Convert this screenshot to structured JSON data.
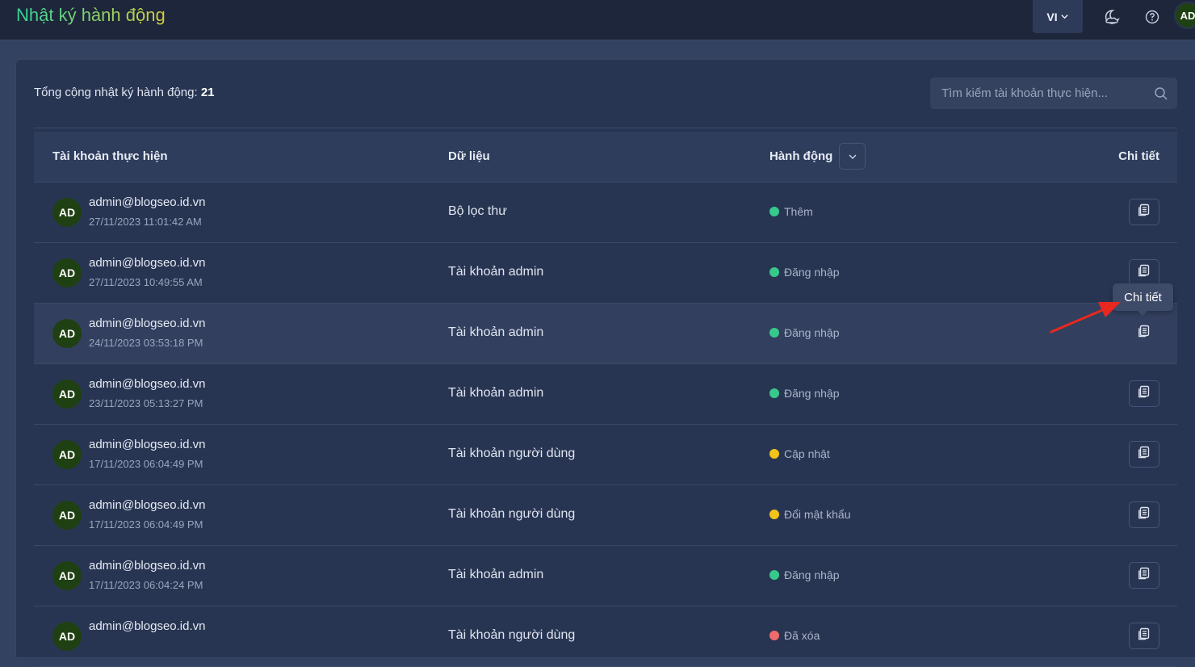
{
  "header": {
    "title": "Nhật ký hành động",
    "language": "VI",
    "avatar_initials": "AD"
  },
  "summary": {
    "label": "Tổng cộng nhật ký hành động:",
    "count": "21"
  },
  "search": {
    "placeholder": "Tìm kiếm tài khoản thực hiện..."
  },
  "table": {
    "columns": {
      "account": "Tài khoản thực hiện",
      "data": "Dữ liệu",
      "action": "Hành động",
      "detail": "Chi tiết"
    },
    "rows": [
      {
        "initials": "AD",
        "email": "admin@blogseo.id.vn",
        "time": "27/11/2023 11:01:42 AM",
        "data": "Bộ lọc thư",
        "action": "Thêm",
        "status_color": "#37c98b"
      },
      {
        "initials": "AD",
        "email": "admin@blogseo.id.vn",
        "time": "27/11/2023 10:49:55 AM",
        "data": "Tài khoản admin",
        "action": "Đăng nhập",
        "status_color": "#37c98b"
      },
      {
        "initials": "AD",
        "email": "admin@blogseo.id.vn",
        "time": "24/11/2023 03:53:18 PM",
        "data": "Tài khoản admin",
        "action": "Đăng nhập",
        "status_color": "#37c98b"
      },
      {
        "initials": "AD",
        "email": "admin@blogseo.id.vn",
        "time": "23/11/2023 05:13:27 PM",
        "data": "Tài khoản admin",
        "action": "Đăng nhập",
        "status_color": "#37c98b"
      },
      {
        "initials": "AD",
        "email": "admin@blogseo.id.vn",
        "time": "17/11/2023 06:04:49 PM",
        "data": "Tài khoản người dùng",
        "action": "Cập nhật",
        "status_color": "#f2c318"
      },
      {
        "initials": "AD",
        "email": "admin@blogseo.id.vn",
        "time": "17/11/2023 06:04:49 PM",
        "data": "Tài khoản người dùng",
        "action": "Đổi mật khẩu",
        "status_color": "#f2c318"
      },
      {
        "initials": "AD",
        "email": "admin@blogseo.id.vn",
        "time": "17/11/2023 06:04:24 PM",
        "data": "Tài khoản admin",
        "action": "Đăng nhập",
        "status_color": "#37c98b"
      },
      {
        "initials": "AD",
        "email": "admin@blogseo.id.vn",
        "time": "",
        "data": "Tài khoản người dùng",
        "action": "Đã xóa",
        "status_color": "#f06b6b"
      }
    ]
  },
  "tooltip": {
    "text": "Chi tiết"
  },
  "colors": {
    "annotation_arrow": "#e8281e"
  }
}
